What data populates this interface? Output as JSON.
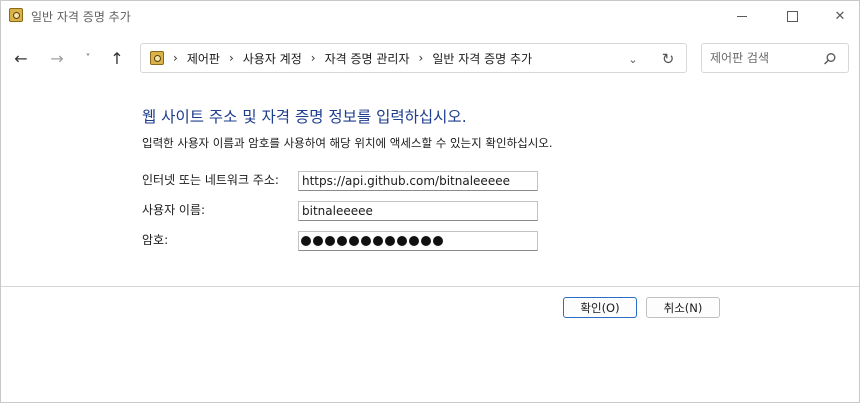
{
  "window": {
    "title": "일반 자격 증명 추가",
    "icon": "credential-manager-icon"
  },
  "titlebar_buttons": {
    "minimize_icon": "minimize-icon",
    "maximize_icon": "maximize-icon",
    "close_icon": "close-icon",
    "close_glyph": "✕"
  },
  "nav": {
    "back_glyph": "←",
    "forward_glyph": "→",
    "recent_glyph": "˅",
    "up_glyph": "↑"
  },
  "breadcrumb": {
    "items": [
      "제어판",
      "사용자 계정",
      "자격 증명 관리자",
      "일반 자격 증명 추가"
    ],
    "separator": "›",
    "dropdown_glyph": "⌄",
    "refresh_glyph": "↻"
  },
  "search": {
    "placeholder": "제어판 검색",
    "value": ""
  },
  "form": {
    "heading": "웹 사이트 주소 및 자격 증명 정보를 입력하십시오.",
    "description": "입력한 사용자 이름과 암호를 사용하여 해당 위치에 액세스할 수 있는지 확인하십시오.",
    "address_label": "인터넷 또는 네트워크 주소:",
    "address_value": "https://api.github.com/bitnaleeeee",
    "username_label": "사용자 이름:",
    "username_value": "bitnaleeeee",
    "password_label": "암호:",
    "password_mask_count": 12
  },
  "buttons": {
    "ok_label": "확인(O)",
    "cancel_label": "취소(N)"
  },
  "colors": {
    "heading": "#1e3d8c",
    "ok_border": "#2b6cc4"
  }
}
